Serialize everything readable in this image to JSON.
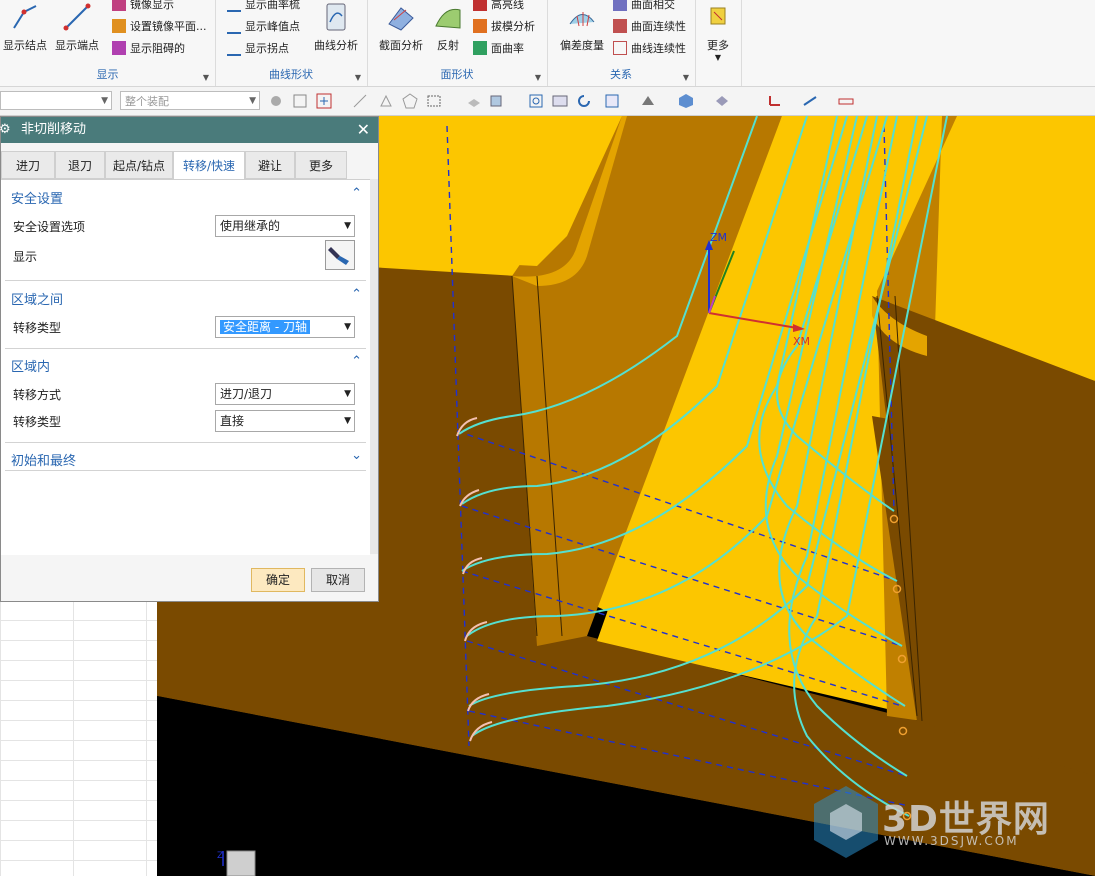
{
  "ribbon": {
    "groups": [
      {
        "label": "显示",
        "buttons": [
          "显示结点",
          "显示端点"
        ],
        "small": [
          "镜像显示",
          "设置镜像平面...",
          "显示阻碍的"
        ]
      },
      {
        "label": "曲线形状",
        "small": [
          "显示曲率梳",
          "显示峰值点",
          "显示拐点"
        ],
        "big": "曲线分析"
      },
      {
        "label": "面形状",
        "buttons": [
          "截面分析",
          "反射"
        ],
        "small": [
          "高亮线",
          "拔模分析",
          "面曲率"
        ]
      },
      {
        "label": "关系",
        "big": "偏差度量",
        "small": [
          "曲面相交",
          "曲面连续性",
          "曲线连续性"
        ]
      },
      {
        "label": "",
        "big": "更多"
      }
    ]
  },
  "toolbar": {
    "combo1": "",
    "combo2": "整个装配"
  },
  "dialog": {
    "title": "非切削移动",
    "tabs": [
      "进刀",
      "退刀",
      "起点/钻点",
      "转移/快速",
      "避让",
      "更多"
    ],
    "active_tab": "转移/快速",
    "sections": {
      "safety": {
        "title": "安全设置",
        "option_label": "安全设置选项",
        "option_value": "使用继承的",
        "display_label": "显示"
      },
      "between": {
        "title": "区域之间",
        "type_label": "转移类型",
        "type_value": "安全距离 - 刀轴"
      },
      "within": {
        "title": "区域内",
        "method_label": "转移方式",
        "method_value": "进刀/退刀",
        "type_label": "转移类型",
        "type_value": "直接"
      },
      "initial": {
        "title": "初始和最终"
      }
    },
    "ok": "确定",
    "cancel": "取消"
  },
  "viewport": {
    "axis_z": "ZM",
    "axis_x": "XM",
    "corner_axis": "Z"
  },
  "watermark": {
    "big": "3D世界网",
    "small": "WWW.3DSJW.COM"
  },
  "colors": {
    "part_top": "#fcc600",
    "part_wall": "#7a4a00",
    "toolpath": "#55e0d0",
    "rapid": "#2030d0",
    "dialog_header": "#4a7b7b",
    "accent": "#2a67b1"
  }
}
